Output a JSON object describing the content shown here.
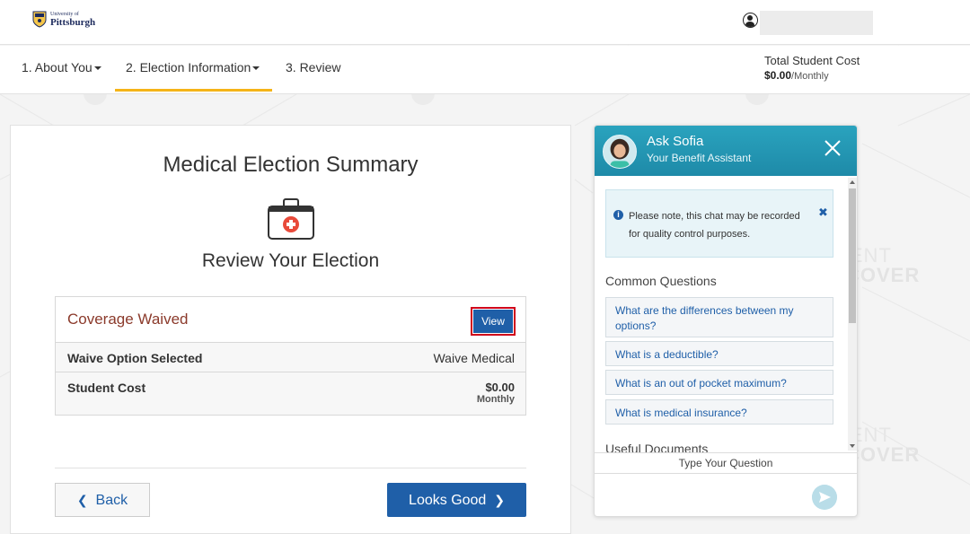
{
  "header": {
    "logo_line1": "University of",
    "logo_line2": "Pittsburgh"
  },
  "nav": {
    "step1": "1. About You",
    "step2": "2. Election Information",
    "step3": "3. Review",
    "total_label": "Total Student Cost",
    "total_amount": "$0.00",
    "total_period": "/Monthly"
  },
  "summary": {
    "title": "Medical Election Summary",
    "subtitle": "Review Your Election",
    "coverage_status": "Coverage Waived",
    "view_label": "View",
    "rows": [
      {
        "label": "Waive Option Selected",
        "value": "Waive Medical"
      },
      {
        "label": "Student Cost",
        "value": "$0.00",
        "period": "Monthly"
      }
    ],
    "back_label": "Back",
    "confirm_label": "Looks Good"
  },
  "chat": {
    "title": "Ask Sofia",
    "subtitle": "Your Benefit Assistant",
    "notice": "Please note, this chat may be recorded for quality control purposes.",
    "common_questions_heading": "Common Questions",
    "questions": [
      "What are the differences between my options?",
      "What is a deductible?",
      "What is an out of pocket maximum?",
      "What is medical insurance?"
    ],
    "useful_documents_heading": "Useful Documents",
    "input_label": "Type Your Question"
  },
  "watermark": {
    "line1": "STUDENT",
    "line2": "MEDICOVER"
  },
  "colors": {
    "primary": "#1f5fa8",
    "accent_underline": "#f5b418",
    "chat_header": "#2aa3be",
    "waived_text": "#8b3a2b",
    "highlight_border": "#d0021b"
  }
}
